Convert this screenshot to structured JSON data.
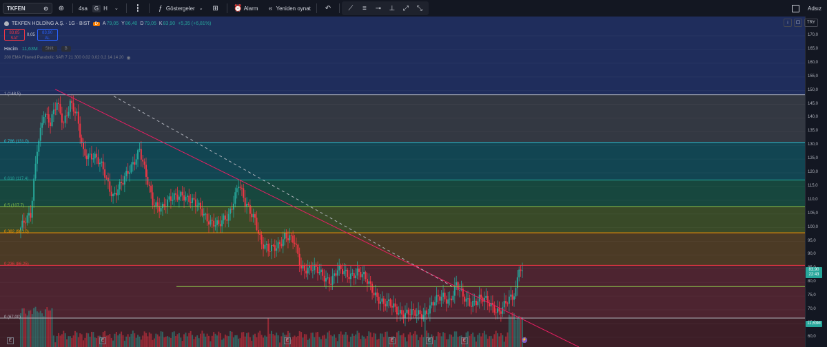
{
  "toolbar": {
    "symbol": "TKFEN",
    "timeframe": "4sa",
    "chart_type_g": "G",
    "chart_type_h": "H",
    "indicators": "Göstergeler",
    "alarm": "Alarm",
    "replay": "Yeniden oynat",
    "layout_name": "Adsız"
  },
  "legend": {
    "title": "TEKFEN HOLDİNG A.Ş. · 1G · BIST",
    "badge": "D",
    "o_label": "A",
    "o_value": "79,05",
    "h_label": "Y",
    "h_value": "86,40",
    "l_label": "D",
    "l_value": "79,05",
    "c_label": "K",
    "c_value": "83,90",
    "change": "+5,35 (+6,81%)"
  },
  "trade": {
    "sell_price": "83,85",
    "sell_label": "SAT",
    "spread": "0,05",
    "buy_price": "83,90",
    "buy_label": "AL"
  },
  "volume_row": {
    "label": "Hacim",
    "value": "11,63M",
    "shift_label": "Shift",
    "b_label": "B"
  },
  "ema_row": {
    "text": "200 EMA Filtered Parabolic SAR 7 21 300 0,02 0,02 0,2 14 14 20"
  },
  "axis": {
    "currency": "TRY",
    "ticks": [
      "170,0",
      "165,0",
      "160,0",
      "155,0",
      "150,0",
      "145,0",
      "140,0",
      "135,0",
      "130,0",
      "125,0",
      "120,0",
      "115,0",
      "110,0",
      "105,0",
      "100,0",
      "95,0",
      "90,0",
      "85,0",
      "80,0",
      "75,0",
      "70,0",
      "65,0",
      "60,0"
    ],
    "price_tag": "83,90",
    "countdown": "22:43",
    "volume_tag": "11,63M"
  },
  "fib_levels": [
    {
      "label": "1 (148,5)",
      "price": 148.5,
      "color": "#b2b5be"
    },
    {
      "label": "0,786 (131,0)",
      "price": 131.0,
      "color": "#26c6da"
    },
    {
      "label": "0,618 (117,4)",
      "price": 117.4,
      "color": "#26a69a"
    },
    {
      "label": "0,5 (107,7)",
      "price": 107.7,
      "color": "#8bc34a"
    },
    {
      "label": "0,382 (98,10)",
      "price": 98.1,
      "color": "#ff9800"
    },
    {
      "label": "0,236 (86,25)",
      "price": 86.25,
      "color": "#f23645"
    },
    {
      "label": "0 (67,00)",
      "price": 67.0,
      "color": "#b2b5be"
    }
  ],
  "colors": {
    "up": "#26a69a",
    "down": "#f23645",
    "background": "#131722",
    "trendline": "#e91e63",
    "support": "#8bc34a"
  },
  "events": [
    "E",
    "E",
    "E",
    "E",
    "E",
    "E",
    "D",
    "⚡"
  ]
}
